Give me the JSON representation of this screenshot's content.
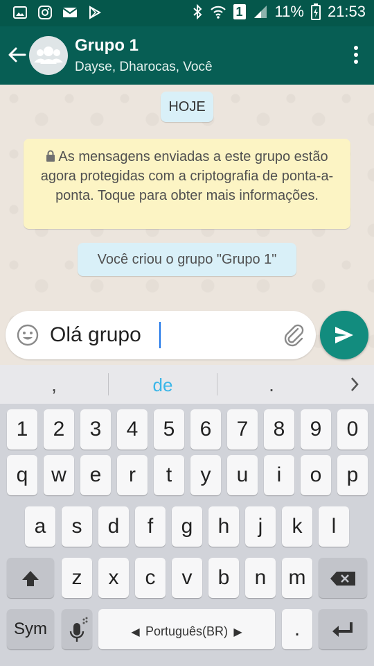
{
  "status_bar": {
    "battery": "11%",
    "sim": "1",
    "time": "21:53"
  },
  "header": {
    "title": "Grupo 1",
    "subtitle": "Dayse, Dharocas, Você"
  },
  "chat": {
    "date_pill": "HOJE",
    "encryption_notice": "As mensagens enviadas a este grupo estão agora protegidas com a criptografia de ponta-a-ponta. Toque para obter mais informações.",
    "system_message": "Você criou o grupo \"Grupo 1\""
  },
  "composer": {
    "value": "Olá grupo"
  },
  "suggestions": [
    ",",
    "de",
    "."
  ],
  "keyboard": {
    "numbers": [
      "1",
      "2",
      "3",
      "4",
      "5",
      "6",
      "7",
      "8",
      "9",
      "0"
    ],
    "row1": [
      "q",
      "w",
      "e",
      "r",
      "t",
      "y",
      "u",
      "i",
      "o",
      "p"
    ],
    "row2": [
      "a",
      "s",
      "d",
      "f",
      "g",
      "h",
      "j",
      "k",
      "l"
    ],
    "row3": [
      "z",
      "x",
      "c",
      "v",
      "b",
      "n",
      "m"
    ],
    "sym_label": "Sym",
    "language_label": "Português(BR)",
    "dot_label": "."
  },
  "colors": {
    "header": "#075e54",
    "status_bar": "#05574b",
    "send_button": "#128c7e",
    "notice_bg": "#fcf4c4",
    "pill_bg": "#d9f0f8",
    "suggestion_highlight": "#3bb6e8"
  }
}
